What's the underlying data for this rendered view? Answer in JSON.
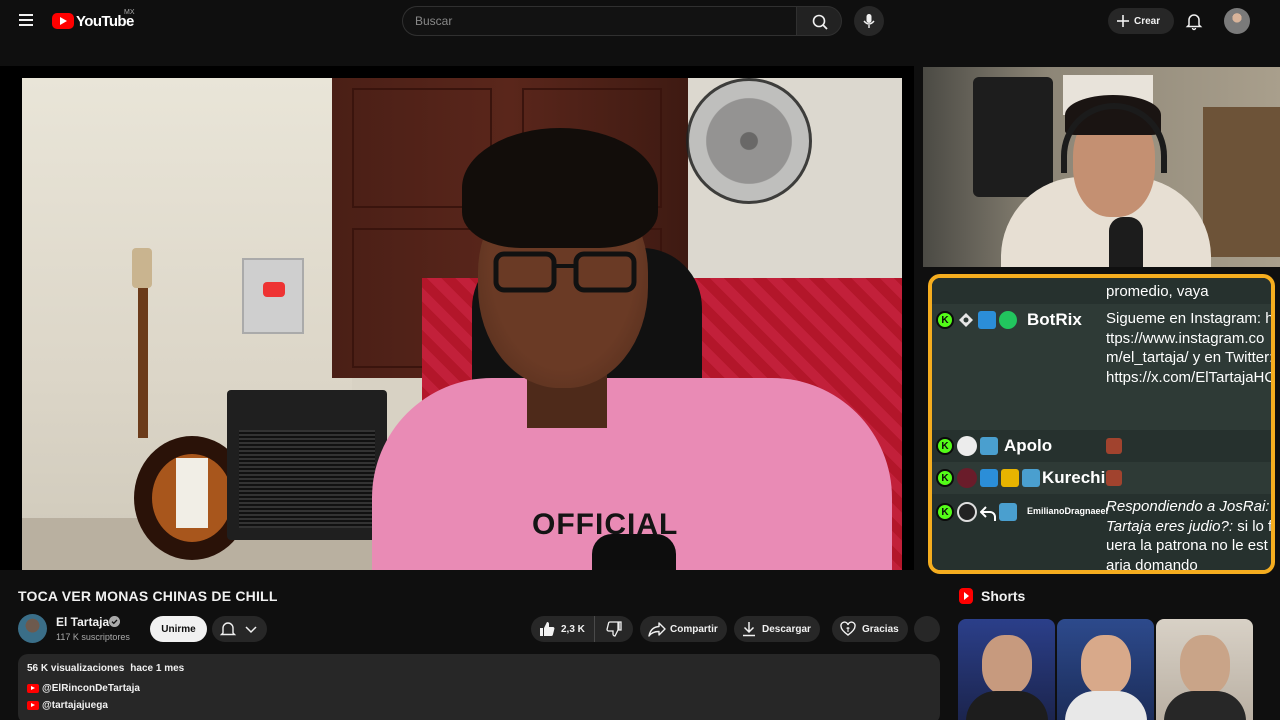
{
  "masthead": {
    "logo_text": "YouTube",
    "country_code": "MX",
    "search_placeholder": "Buscar",
    "create_label": "Crear"
  },
  "video": {
    "shirt_print": "OFFICIAL",
    "title": "TOCA VER MONAS CHINAS DE CHILL"
  },
  "channel": {
    "name": "El Tartaja",
    "subscribers": "117 K suscriptores",
    "join_label": "Unirme"
  },
  "actions": {
    "likes": "2,3 K",
    "share_label": "Compartir",
    "download_label": "Descargar",
    "thanks_label": "Gracias"
  },
  "description": {
    "views": "56 K visualizaciones",
    "date": "hace 1 mes",
    "links": [
      "@ElRinconDeTartaja",
      "@tartajajuega"
    ]
  },
  "chat": {
    "messages": [
      {
        "user": "",
        "text": "promedio, vaya"
      },
      {
        "user": "BotRix",
        "text": "Sigueme en Instagram: https://www.instagram.com/el_tartaja/ y en Twitter: https://x.com/ElTartajaHC"
      },
      {
        "user": "Apolo",
        "text": ""
      },
      {
        "user": "Kurechi",
        "text": ""
      },
      {
        "user": "EmilianoDragnaeel",
        "reply_prefix": "Respondiendo a JosRai: Tartaja eres judio?:",
        "text": " si lo fuera la patrona no le estaria domando"
      }
    ]
  },
  "shorts": {
    "title": "Shorts"
  },
  "colors": {
    "background": "#0f0f0f",
    "brand_red": "#ff0000",
    "chat_border": "#f5ad1f",
    "chat_background": "#2e3a36",
    "kick_green": "#53fc18"
  },
  "icons": [
    "menu-icon",
    "youtube-logo",
    "search-icon",
    "mic-icon",
    "plus-icon",
    "bell-icon",
    "verified-icon",
    "like-icon",
    "dislike-icon",
    "share-icon",
    "download-icon",
    "thanks-icon",
    "shorts-icon"
  ]
}
